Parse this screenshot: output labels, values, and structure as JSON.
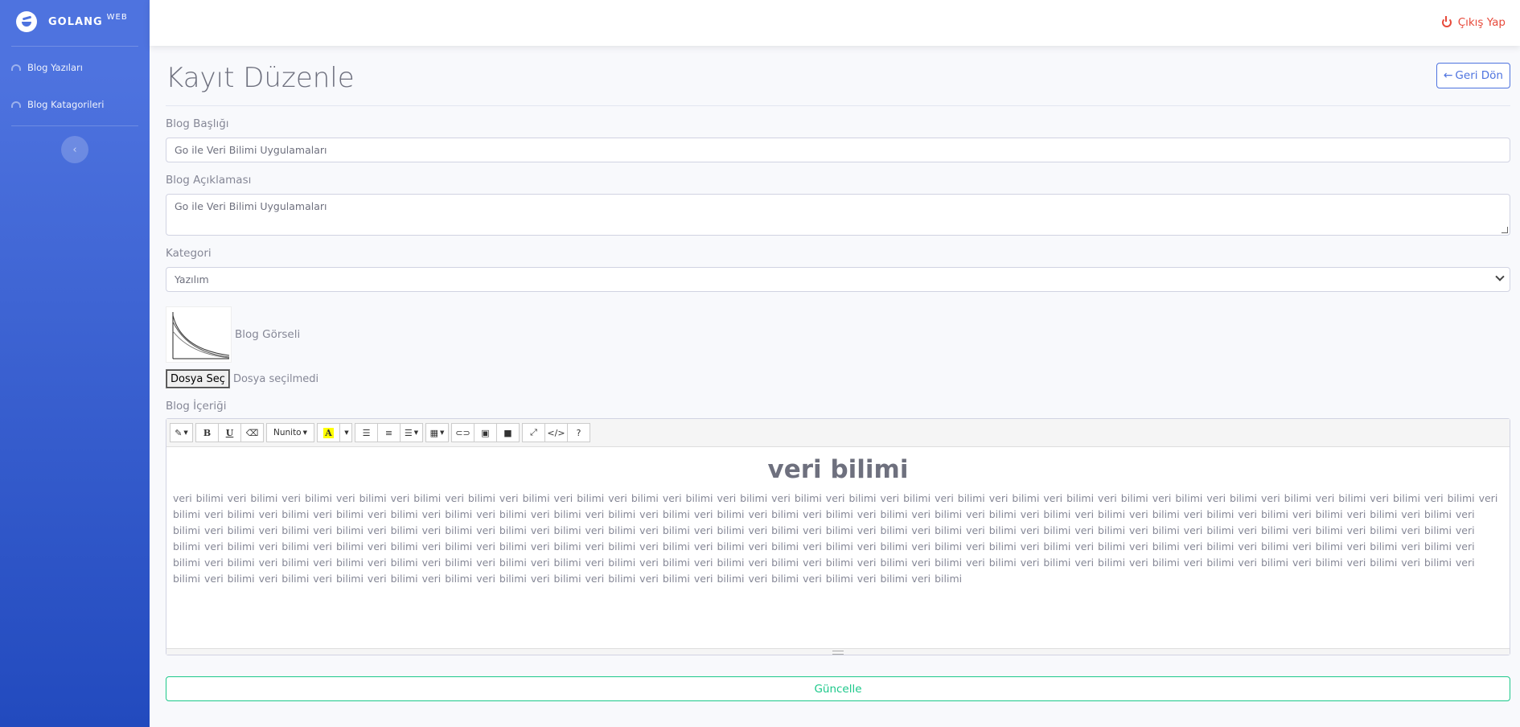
{
  "brand": {
    "name": "GOLANG",
    "sup": "WEB"
  },
  "sidebar": {
    "items": [
      {
        "label": "Blog Yazıları"
      },
      {
        "label": "Blog Katagorileri"
      }
    ],
    "toggle_glyph": "‹"
  },
  "topbar": {
    "logout_label": "Çıkış Yap"
  },
  "page": {
    "title": "Kayıt Düzenle",
    "back_label": "Geri Dön"
  },
  "form": {
    "title_label": "Blog Başlığı",
    "title_value": "Go ile Veri Bilimi Uygulamaları",
    "description_label": "Blog Açıklaması",
    "description_value": "Go ile Veri Bilimi Uygulamaları",
    "category_label": "Kategori",
    "category_value": "Yazılım",
    "image_label": "Blog Görseli",
    "file_button": "Dosya Seç",
    "file_status": "Dosya seçilmedi",
    "content_label": "Blog İçeriği",
    "submit_label": "Güncelle"
  },
  "editor": {
    "toolbar": {
      "font_name": "Nunito",
      "color_letter": "A"
    },
    "heading": "veri bilimi",
    "body": "veri bilimi veri bilimi veri bilimi veri bilimi veri bilimi veri bilimi veri bilimi veri bilimi veri bilimi veri bilimi veri bilimi veri bilimi veri bilimi veri bilimi veri bilimi veri bilimi veri bilimi veri bilimi veri bilimi veri bilimi veri bilimi veri bilimi veri bilimi veri bilimi veri bilimi veri bilimi veri bilimi veri bilimi veri bilimi veri bilimi veri bilimi veri bilimi veri bilimi veri bilimi veri bilimi veri bilimi veri bilimi veri bilimi veri bilimi veri bilimi veri bilimi veri bilimi veri bilimi veri bilimi veri bilimi veri bilimi veri bilimi veri bilimi veri bilimi veri bilimi veri bilimi veri bilimi veri bilimi veri bilimi veri bilimi veri bilimi veri bilimi veri bilimi veri bilimi veri bilimi veri bilimi veri bilimi veri bilimi veri bilimi veri bilimi veri bilimi veri bilimi veri bilimi veri bilimi veri bilimi veri bilimi veri bilimi veri bilimi veri bilimi veri bilimi veri bilimi veri bilimi veri bilimi veri bilimi veri bilimi veri bilimi veri bilimi veri bilimi veri bilimi veri bilimi veri bilimi veri bilimi veri bilimi veri bilimi veri bilimi veri bilimi veri bilimi veri bilimi veri bilimi veri bilimi veri bilimi veri bilimi veri bilimi veri bilimi veri bilimi veri bilimi veri bilimi veri bilimi veri bilimi veri bilimi veri bilimi veri bilimi veri bilimi veri bilimi veri bilimi veri bilimi veri bilimi veri bilimi veri bilimi veri bilimi veri bilimi veri bilimi veri bilimi veri bilimi veri bilimi veri bilimi veri bilimi veri bilimi veri bilimi veri bilimi veri bilimi veri bilimi veri bilimi veri bilimi veri bilimi veri bilimi veri bilimi veri bilimi veri bilimi veri bilimi"
  },
  "colors": {
    "sidebar_start": "#4e73df",
    "sidebar_end": "#224abe",
    "danger": "#e74a3b",
    "primary": "#4e73df",
    "success": "#1cc88a"
  }
}
